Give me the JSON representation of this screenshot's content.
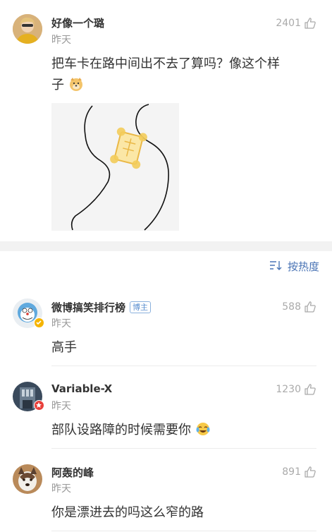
{
  "sort": {
    "label": "按热度"
  },
  "comments": [
    {
      "username": "好像一个璐",
      "time": "昨天",
      "likes": "2401",
      "text_line1": "把车卡在路中间出不去了算吗？像这个样",
      "text_line2": "子"
    },
    {
      "username": "微博搞笑排行榜",
      "badge": "博主",
      "time": "昨天",
      "likes": "588",
      "text": "高手"
    },
    {
      "username": "Variable-X",
      "time": "昨天",
      "likes": "1230",
      "text": "部队设路障的时候需要你"
    },
    {
      "username": "阿轰的峰",
      "time": "昨天",
      "likes": "891",
      "text": "你是漂进去的吗这么窄的路"
    }
  ],
  "colors": {
    "link": "#4a74b5",
    "muted": "#999999",
    "band": "#f2f2f2"
  }
}
